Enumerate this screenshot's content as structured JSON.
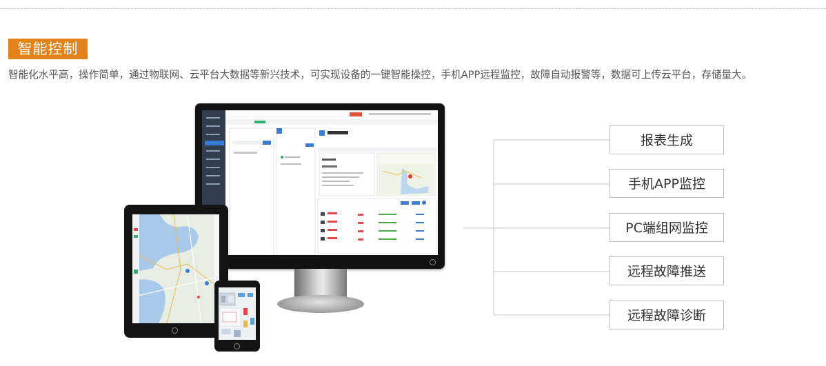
{
  "section": {
    "tag": "智能控制",
    "description": "智能化水平高，操作简单，通过物联网、云平台大数据等新兴技术，可实现设备的一键智能操控，手机APP远程监控，故障自动报警等，数据可上传云平台，存储量大。"
  },
  "features": [
    {
      "label": "报表生成"
    },
    {
      "label": "手机APP监控"
    },
    {
      "label": "PC端组网监控"
    },
    {
      "label": "远程故障推送"
    },
    {
      "label": "远程故障诊断"
    }
  ],
  "colors": {
    "accent": "#e3821b",
    "sidebar": "#2f3d4f",
    "link": "#3a7bd5"
  }
}
